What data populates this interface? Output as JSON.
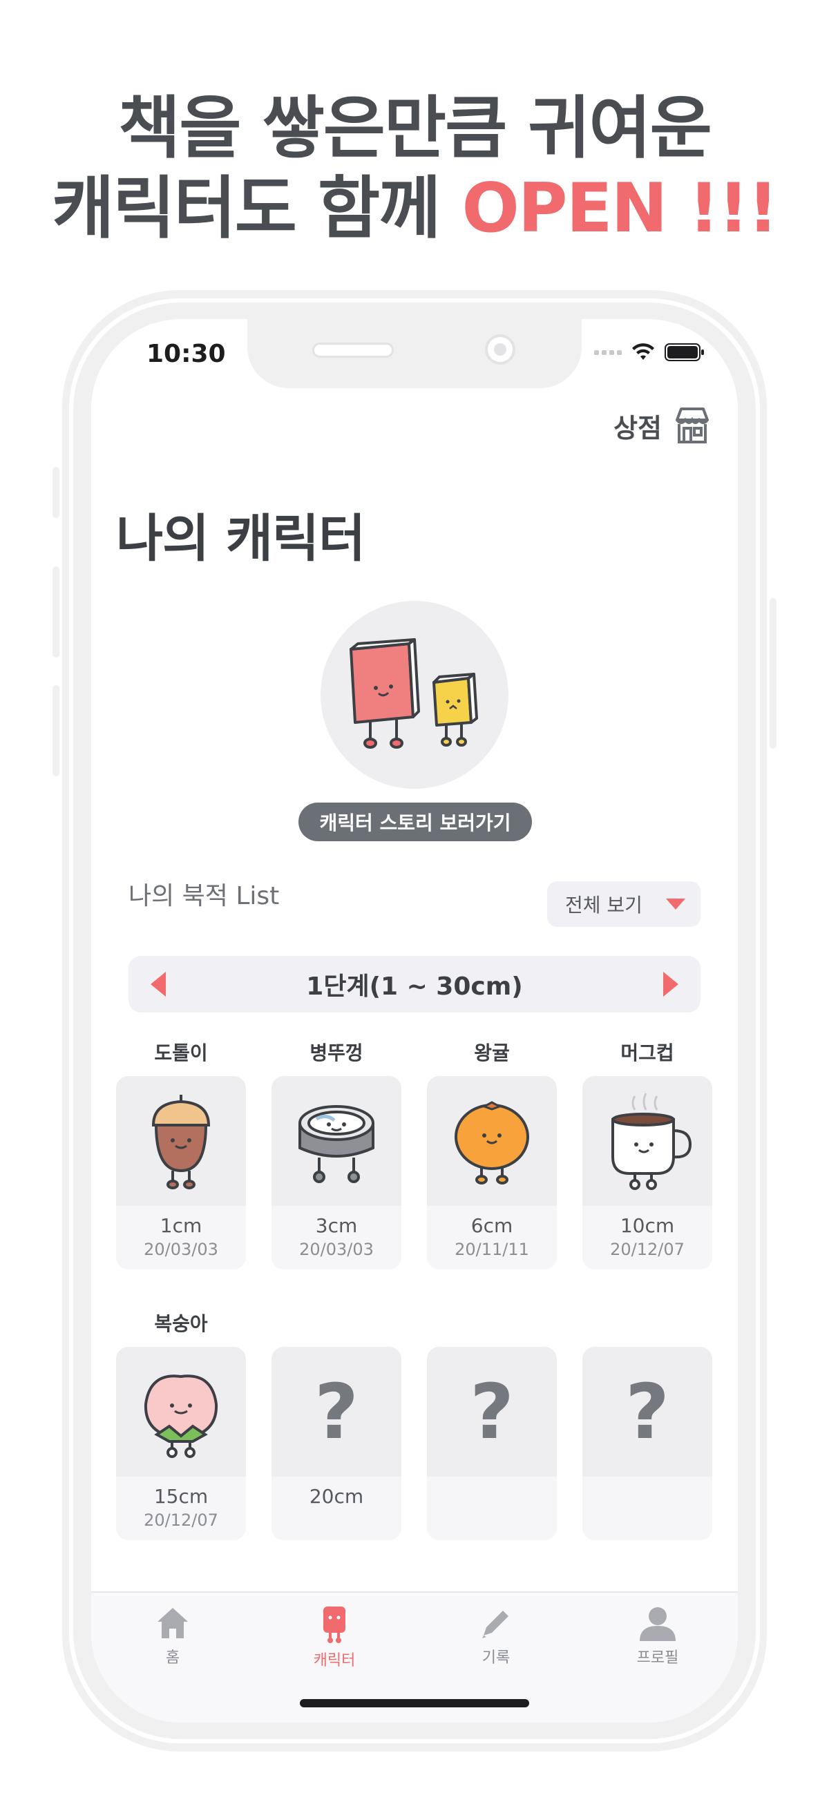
{
  "promo": {
    "line1": "책을 쌓은만큼 귀여운",
    "line2_main": "캐릭터도 함께 ",
    "line2_accent": "OPEN !!!"
  },
  "status_bar": {
    "time": "10:30"
  },
  "header": {
    "shop_label": "상점",
    "shop_icon": "store-icon"
  },
  "page": {
    "title": "나의 캐릭터"
  },
  "hero": {
    "story_button": "캐릭터 스토리 보러가기"
  },
  "list": {
    "title": "나의 북적 List",
    "filter_label": "전체 보기",
    "level_label": "1단계(1 ~ 30cm)"
  },
  "characters": [
    {
      "name": "도톨이",
      "size": "1cm",
      "date": "20/03/03"
    },
    {
      "name": "병뚜껑",
      "size": "3cm",
      "date": "20/03/03"
    },
    {
      "name": "왕귤",
      "size": "6cm",
      "date": "20/11/11"
    },
    {
      "name": "머그컵",
      "size": "10cm",
      "date": "20/12/07"
    },
    {
      "name": "복숭아",
      "size": "15cm",
      "date": "20/12/07"
    },
    {
      "name": "",
      "size": "20cm",
      "date": "",
      "locked_mark": "?"
    },
    {
      "name": "",
      "size": "",
      "date": "",
      "locked_mark": "?"
    },
    {
      "name": "",
      "size": "",
      "date": "",
      "locked_mark": "?"
    }
  ],
  "tabs": [
    {
      "label": "홈",
      "icon": "home-icon"
    },
    {
      "label": "캐릭터",
      "icon": "character-icon",
      "active": true
    },
    {
      "label": "기록",
      "icon": "pencil-icon"
    },
    {
      "label": "프로필",
      "icon": "profile-icon"
    }
  ],
  "colors": {
    "accent": "#f06a6e",
    "text_dark": "#3c3f44",
    "card_bg": "#eeeef0"
  }
}
